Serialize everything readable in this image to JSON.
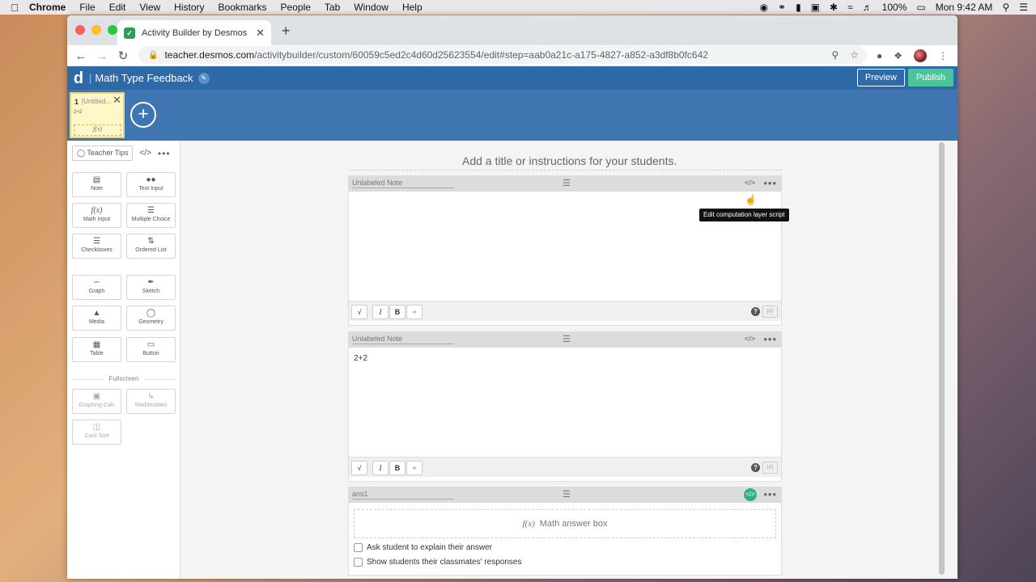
{
  "menubar": {
    "items": [
      "Chrome",
      "File",
      "Edit",
      "View",
      "History",
      "Bookmarks",
      "People",
      "Tab",
      "Window",
      "Help"
    ],
    "battery": "100%",
    "clock": "Mon 9:42 AM"
  },
  "browser": {
    "tab_title": "Activity Builder by Desmos",
    "url_host": "teacher.desmos.com",
    "url_path": "/activitybuilder/custom/60059c5ed2c4d60d25623554/edit#step=aab0a21c-a175-4827-a852-a3df8b0fc642"
  },
  "app": {
    "logo": "d",
    "title": "Math Type Feedback",
    "preview_label": "Preview",
    "publish_label": "Publish",
    "accent": "#2f6aa8",
    "publish_color": "#4cc49a"
  },
  "screens": {
    "current": {
      "number": "1",
      "name": "[Untitled...",
      "preview_text": "2+2",
      "preview_math": "f(x)"
    }
  },
  "sidebar": {
    "teacher_tips": "Teacher Tips",
    "components": [
      {
        "label": "Note",
        "icon": "note-icon"
      },
      {
        "label": "Text Input",
        "icon": "text-input-icon"
      },
      {
        "label": "Math Input",
        "icon": "fx-icon"
      },
      {
        "label": "Multiple Choice",
        "icon": "list-icon"
      },
      {
        "label": "Checkboxes",
        "icon": "checkbox-list-icon"
      },
      {
        "label": "Ordered List",
        "icon": "ordered-list-icon"
      },
      {
        "label": "Graph",
        "icon": "graph-icon"
      },
      {
        "label": "Sketch",
        "icon": "sketch-icon"
      },
      {
        "label": "Media",
        "icon": "media-icon"
      },
      {
        "label": "Geometry",
        "icon": "geometry-icon"
      },
      {
        "label": "Table",
        "icon": "table-icon"
      },
      {
        "label": "Button",
        "icon": "button-icon"
      }
    ],
    "fullscreen_label": "Fullscreen",
    "fullscreen_components": [
      {
        "label": "Graphing Calc",
        "icon": "graphing-calc-icon"
      },
      {
        "label": "Marbleslides",
        "icon": "marbleslides-icon"
      },
      {
        "label": "Card Sort",
        "icon": "card-sort-icon"
      }
    ]
  },
  "main": {
    "instructions_placeholder": "Add a title or instructions for your students.",
    "tooltip": "Edit computation layer script",
    "cards": [
      {
        "name": "Unlabeled Note",
        "body": ""
      },
      {
        "name": "Unlabeled Note",
        "body": "2+2"
      },
      {
        "name": "ans1",
        "math_placeholder": "Math answer box",
        "fx": "f(x)",
        "options": [
          "Ask student to explain their answer",
          "Show students their classmates' responses"
        ]
      }
    ]
  }
}
